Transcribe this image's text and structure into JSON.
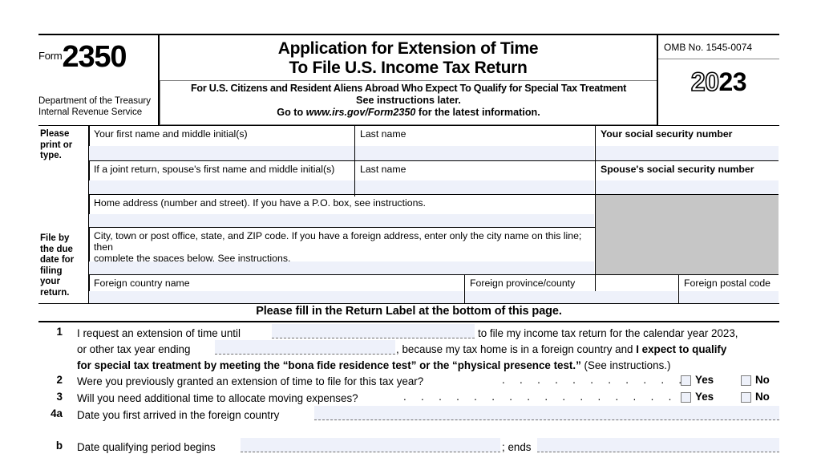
{
  "header": {
    "form_word": "Form",
    "form_number": "2350",
    "department_line1": "Department of the Treasury",
    "department_line2": "Internal Revenue Service",
    "title_line1": "Application for Extension of Time",
    "title_line2": "To File U.S. Income Tax Return",
    "subtitle_line1": "For U.S. Citizens and Resident Aliens Abroad Who Expect To Qualify for Special Tax Treatment",
    "subtitle_line2": "See instructions later.",
    "subtitle_line3_pre": "Go to ",
    "subtitle_line3_url": "www.irs.gov/Form2350",
    "subtitle_line3_post": " for the latest information.",
    "omb": "OMB No. 1545-0074",
    "year_hollow": "20",
    "year_solid": "23"
  },
  "entity": {
    "please_print": "Please\nprint or\ntype.",
    "file_by": "File by\nthe due\ndate for\nfiling\nyour\nreturn.",
    "first_name": "Your first name and middle initial(s)",
    "last_name_1": "Last name",
    "ssn_you": "Your social security number",
    "spouse_first_name": "If a joint return, spouse's first name and middle initial(s)",
    "last_name_2": "Last name",
    "ssn_spouse": "Spouse's social security number",
    "home_address": "Home address (number and street). If you have a P.O. box, see instructions.",
    "city_line1": "City, town or post office, state, and ZIP code. If you have a foreign address, enter only the city name on this line; then",
    "city_line2": "complete the spaces below. See instructions.",
    "foreign_country": "Foreign country name",
    "foreign_province": "Foreign province/county",
    "foreign_postal": "Foreign postal code"
  },
  "notice": "Please fill in the Return Label at the bottom of this page.",
  "lines": {
    "l1_num": "1",
    "l1a_pre": "I request an extension of time until",
    "l1a_post": "to file my income tax return for the calendar year 2023,",
    "l1b_pre": "or other tax year ending",
    "l1b_mid": ", because my tax home is in a foreign country and ",
    "l1b_bold": "I expect to qualify",
    "l1c_bold": "for special tax treatment by meeting the “bona fide residence test” or the “physical presence test.”",
    "l1c_tail": " (See instructions.)",
    "l2_num": "2",
    "l2_text": "Were you previously granted an extension of time to file for this tax year?",
    "l2_dots": ". . . . . . . . . . .",
    "l3_num": "3",
    "l3_text": "Will you need additional time to allocate moving expenses?",
    "l3_dots": ". . . . . . . . . . . . . . . .",
    "l4a_num": "4a",
    "l4a_text": "Date you first arrived in the foreign country",
    "lb_num": "b",
    "lb_text": "Date qualifying period begins",
    "lb_mid": "; ends",
    "yes_label": "Yes",
    "no_label": "No"
  },
  "colors": {
    "field_fill": "#eef1fa",
    "gray_block": "#c6c6c6",
    "rule": "#000000"
  }
}
